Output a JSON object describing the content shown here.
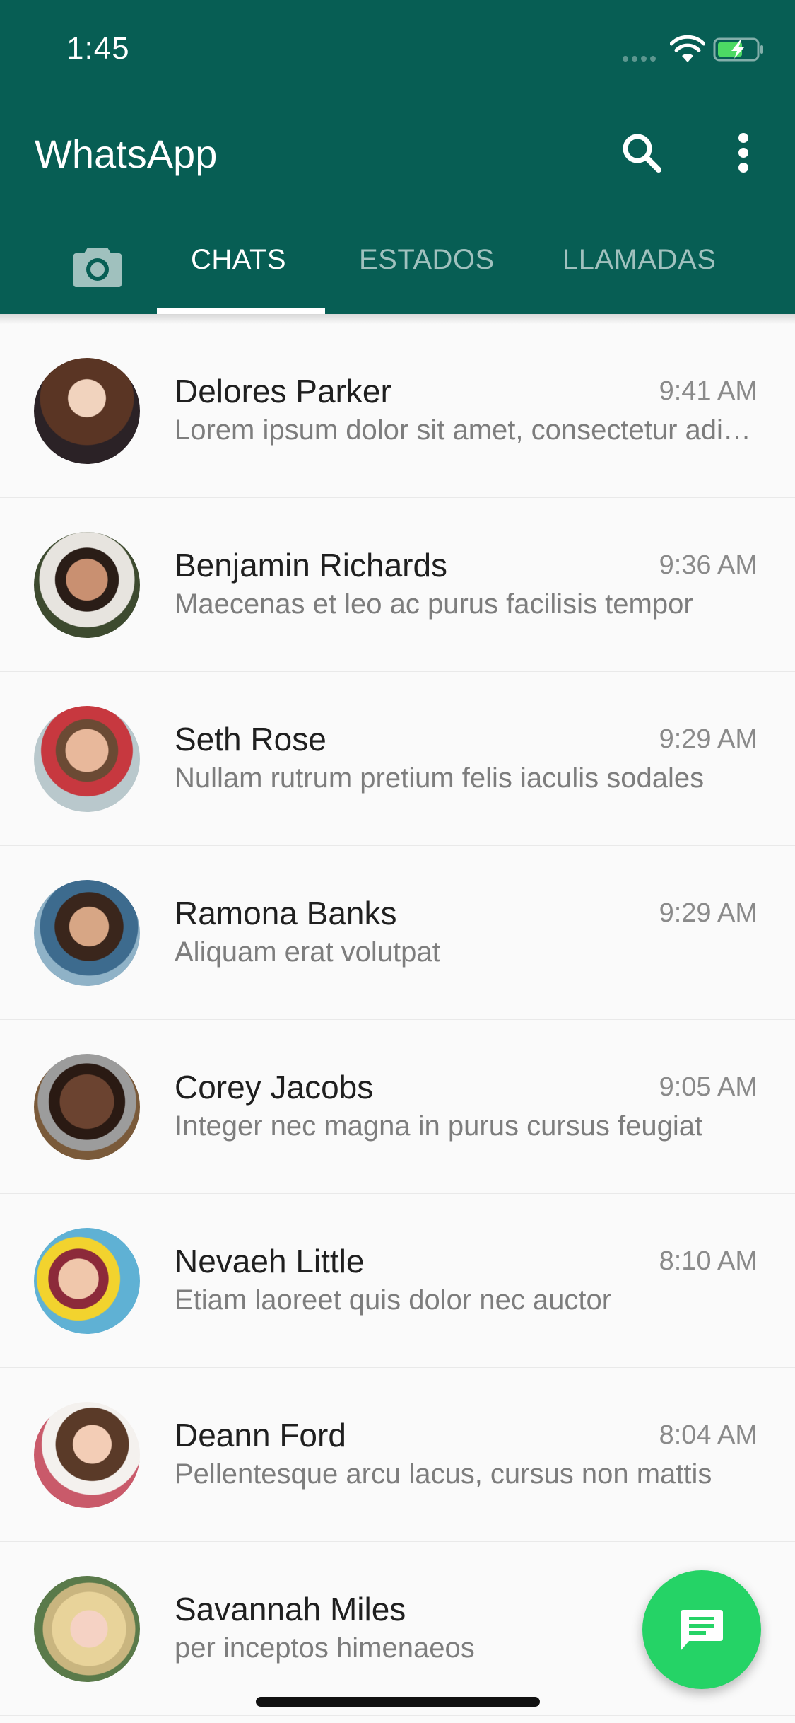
{
  "status_bar": {
    "time": "1:45"
  },
  "app": {
    "title": "WhatsApp"
  },
  "tabs": [
    {
      "label": "CHATS",
      "active": true
    },
    {
      "label": "ESTADOS",
      "active": false
    },
    {
      "label": "LLAMADAS",
      "active": false
    }
  ],
  "icons": {
    "camera": "camera-icon",
    "search": "search-icon",
    "more": "more-vert-icon",
    "fab": "new-chat-icon"
  },
  "colors": {
    "primary": "#075e54",
    "accent": "#25d366",
    "background": "#fafafa"
  },
  "chats": [
    {
      "name": "Delores Parker",
      "time": "9:41 AM",
      "message": "Lorem ipsum dolor sit amet, consectetur adipiscing elit"
    },
    {
      "name": "Benjamin Richards",
      "time": "9:36 AM",
      "message": "Maecenas et leo ac purus facilisis tempor"
    },
    {
      "name": "Seth Rose",
      "time": "9:29 AM",
      "message": "Nullam rutrum pretium felis iaculis sodales"
    },
    {
      "name": "Ramona Banks",
      "time": "9:29 AM",
      "message": "Aliquam erat volutpat"
    },
    {
      "name": "Corey Jacobs",
      "time": "9:05 AM",
      "message": "Integer nec magna in purus cursus feugiat"
    },
    {
      "name": "Nevaeh Little",
      "time": "8:10 AM",
      "message": "Etiam laoreet quis dolor nec auctor"
    },
    {
      "name": "Deann Ford",
      "time": "8:04 AM",
      "message": "Pellentesque arcu lacus, cursus non mattis"
    },
    {
      "name": "Savannah Miles",
      "time": "",
      "message": "per inceptos himenaeos"
    }
  ]
}
